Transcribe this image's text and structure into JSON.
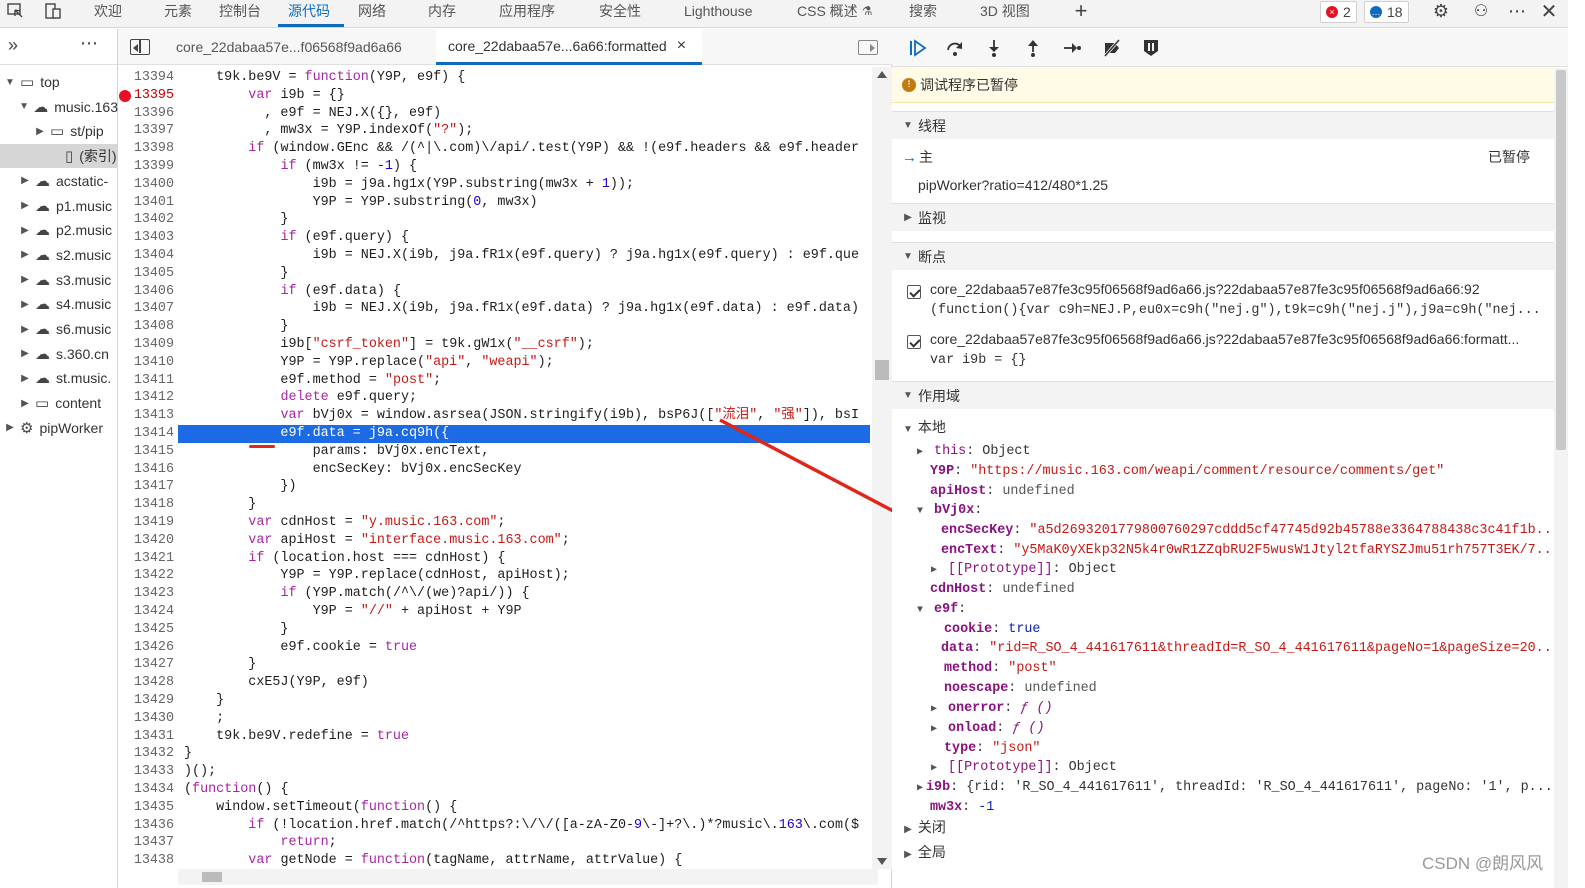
{
  "topbar": {
    "tabs": [
      "欢迎",
      "元素",
      "控制台",
      "源代码",
      "网络",
      "内存",
      "应用程序",
      "安全性",
      "Lighthouse",
      "CSS 概述",
      "搜索",
      "3D 视图"
    ],
    "active_tab": "源代码",
    "errors_count": "2",
    "messages_count": "18",
    "colors": {
      "accent": "#0f6cbd",
      "error": "#e81123",
      "info": "#0f6cbd"
    }
  },
  "navigator": {
    "items": [
      {
        "label": "top",
        "icon": "frame-icon"
      },
      {
        "label": "music.163",
        "icon": "cloud-icon"
      },
      {
        "label": "st/pip",
        "icon": "folder-icon"
      },
      {
        "label": "(索引)",
        "icon": "file-icon"
      },
      {
        "label": "acstatic-",
        "icon": "cloud-icon"
      },
      {
        "label": "p1.music",
        "icon": "cloud-icon"
      },
      {
        "label": "p2.music",
        "icon": "cloud-icon"
      },
      {
        "label": "s2.music",
        "icon": "cloud-icon"
      },
      {
        "label": "s3.music",
        "icon": "cloud-icon"
      },
      {
        "label": "s4.music",
        "icon": "cloud-icon"
      },
      {
        "label": "s6.music",
        "icon": "cloud-icon"
      },
      {
        "label": "s.360.cn",
        "icon": "cloud-icon"
      },
      {
        "label": "st.music.",
        "icon": "cloud-icon"
      },
      {
        "label": "content",
        "icon": "frame-icon"
      },
      {
        "label": "pipWorker",
        "icon": "gear-icon"
      }
    ]
  },
  "editor": {
    "tabs": [
      "core_22dabaa57e...f06568f9ad6a66",
      "core_22dabaa57e...6a66:formatted"
    ],
    "close_glyph": "×",
    "lines": [
      {
        "n": "13394",
        "t": "    t9k.be9V = function(Y9P, e9f) {"
      },
      {
        "n": "13395",
        "t": "        var i9b = {}"
      },
      {
        "n": "13396",
        "t": "          , e9f = NEJ.X({}, e9f)"
      },
      {
        "n": "13397",
        "t": "          , mw3x = Y9P.indexOf(\"?\");"
      },
      {
        "n": "13398",
        "t": "        if (window.GEnc && /(^|\\.com)\\/api/.test(Y9P) && !(e9f.headers && e9f.header"
      },
      {
        "n": "13399",
        "t": "            if (mw3x != -1) {"
      },
      {
        "n": "13400",
        "t": "                i9b = j9a.hg1x(Y9P.substring(mw3x + 1));"
      },
      {
        "n": "13401",
        "t": "                Y9P = Y9P.substring(0, mw3x)"
      },
      {
        "n": "13402",
        "t": "            }"
      },
      {
        "n": "13403",
        "t": "            if (e9f.query) {"
      },
      {
        "n": "13404",
        "t": "                i9b = NEJ.X(i9b, j9a.fR1x(e9f.query) ? j9a.hg1x(e9f.query) : e9f.que"
      },
      {
        "n": "13405",
        "t": "            }"
      },
      {
        "n": "13406",
        "t": "            if (e9f.data) {"
      },
      {
        "n": "13407",
        "t": "                i9b = NEJ.X(i9b, j9a.fR1x(e9f.data) ? j9a.hg1x(e9f.data) : e9f.data)"
      },
      {
        "n": "13408",
        "t": "            }"
      },
      {
        "n": "13409",
        "t": "            i9b[\"csrf_token\"] = t9k.gW1x(\"__csrf\");"
      },
      {
        "n": "13410",
        "t": "            Y9P = Y9P.replace(\"api\", \"weapi\");"
      },
      {
        "n": "13411",
        "t": "            e9f.method = \"post\";"
      },
      {
        "n": "13412",
        "t": "            delete e9f.query;"
      },
      {
        "n": "13413",
        "t": "            var bVj0x = window.asrsea(JSON.stringify(i9b), bsP6J([\"流泪\", \"强\"]), bsI"
      },
      {
        "n": "13414",
        "t": "            e9f.data = j9a.cq9h({"
      },
      {
        "n": "13415",
        "t": "                params: bVj0x.encText,"
      },
      {
        "n": "13416",
        "t": "                encSecKey: bVj0x.encSecKey"
      },
      {
        "n": "13417",
        "t": "            })"
      },
      {
        "n": "13418",
        "t": "        }"
      },
      {
        "n": "13419",
        "t": "        var cdnHost = \"y.music.163.com\";"
      },
      {
        "n": "13420",
        "t": "        var apiHost = \"interface.music.163.com\";"
      },
      {
        "n": "13421",
        "t": "        if (location.host === cdnHost) {"
      },
      {
        "n": "13422",
        "t": "            Y9P = Y9P.replace(cdnHost, apiHost);"
      },
      {
        "n": "13423",
        "t": "            if (Y9P.match(/^\\/(we)?api/)) {"
      },
      {
        "n": "13424",
        "t": "                Y9P = \"//\" + apiHost + Y9P"
      },
      {
        "n": "13425",
        "t": "            }"
      },
      {
        "n": "13426",
        "t": "            e9f.cookie = true"
      },
      {
        "n": "13427",
        "t": "        }"
      },
      {
        "n": "13428",
        "t": "        cxE5J(Y9P, e9f)"
      },
      {
        "n": "13429",
        "t": "    }"
      },
      {
        "n": "13430",
        "t": "    ;"
      },
      {
        "n": "13431",
        "t": "    t9k.be9V.redefine = true"
      },
      {
        "n": "13432",
        "t": "}"
      },
      {
        "n": "13433",
        "t": ")();"
      },
      {
        "n": "13434",
        "t": "(function() {"
      },
      {
        "n": "13435",
        "t": "    window.setTimeout(function() {"
      },
      {
        "n": "13436",
        "t": "        if (!location.href.match(/^https?:\\/\\/([a-zA-Z0-9\\-]+?\\.)*?music\\.163\\.com($"
      },
      {
        "n": "13437",
        "t": "            return;"
      },
      {
        "n": "13438",
        "t": "        var getNode = function(tagName, attrName, attrValue) {"
      }
    ]
  },
  "debugger": {
    "paused_text": "调试程序已暂停",
    "threads_label": "线程",
    "main_thread": "主",
    "main_thread_status": "已暂停",
    "worker_thread": "pipWorker?ratio=412/480*1.25",
    "watch_label": "监视",
    "breakpoints_label": "断点",
    "breakpoints": [
      {
        "file": "core_22dabaa57e87fe3c95f06568f9ad6a66.js?22dabaa57e87fe3c95f06568f9ad6a66:92",
        "code": "(function(){var c9h=NEJ.P,eu0x=c9h(\"nej.g\"),t9k=c9h(\"nej.j\"),j9a=c9h(\"nej..."
      },
      {
        "file": "core_22dabaa57e87fe3c95f06568f9ad6a66.js?22dabaa57e87fe3c95f06568f9ad6a66:formatt...",
        "code": "var i9b = {}"
      }
    ],
    "scope_label": "作用域",
    "local_label": "本地",
    "closure_label": "关闭",
    "global_label": "全局",
    "scope": {
      "this_val": "Object",
      "Y9P_val": "\"https://music.163.com/weapi/comment/resource/comments/get\"",
      "apiHost_val": "undefined",
      "encSecKey_val": "\"a5d2693201779800760297cddd5cf47745d92b45788e3364788438c3c41f1b...",
      "encText_val": "\"y5MaK0yXEkp32N5k4r0wR1ZZqbRU2F5wusW1Jtyl2tfaRYSZJmu51rh757T3EK/7...",
      "prototype_val": "Object",
      "cdnHost_val": "undefined",
      "cookie_val": "true",
      "data_val": "\"rid=R_SO_4_441617611&threadId=R_SO_4_441617611&pageNo=1&pageSize=20...",
      "method_val": "\"post\"",
      "noescape_val": "undefined",
      "onerror_val": "ƒ ()",
      "onload_val": "ƒ ()",
      "type_val": "\"json\"",
      "i9b_val": "{rid: 'R_SO_4_441617611', threadId: 'R_SO_4_441617611', pageNo: '1', p...",
      "mw3x_val": "-1"
    }
  },
  "watermark": "CSDN @朗风风"
}
